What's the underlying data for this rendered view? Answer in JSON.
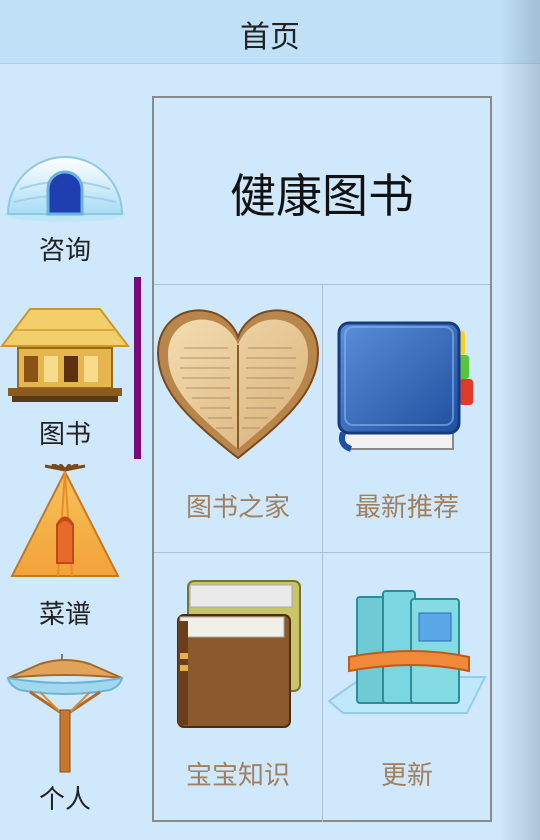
{
  "header": {
    "title": "首页"
  },
  "sidebar": {
    "items": [
      {
        "label": "咨询",
        "icon": "igloo-icon"
      },
      {
        "label": "图书",
        "icon": "pavilion-icon",
        "active": true
      },
      {
        "label": "菜谱",
        "icon": "tipi-icon"
      },
      {
        "label": "个人",
        "icon": "watchtower-icon"
      }
    ],
    "active_color": "#7a0a7d"
  },
  "panel": {
    "title": "健康图书",
    "cells": [
      {
        "label": "图书之家",
        "icon": "heart-book-icon"
      },
      {
        "label": "最新推荐",
        "icon": "blue-book-icon"
      },
      {
        "label": "宝宝知识",
        "icon": "book-stack-icon"
      },
      {
        "label": "更新",
        "icon": "books-update-icon"
      }
    ],
    "label_color": "#a08060"
  }
}
